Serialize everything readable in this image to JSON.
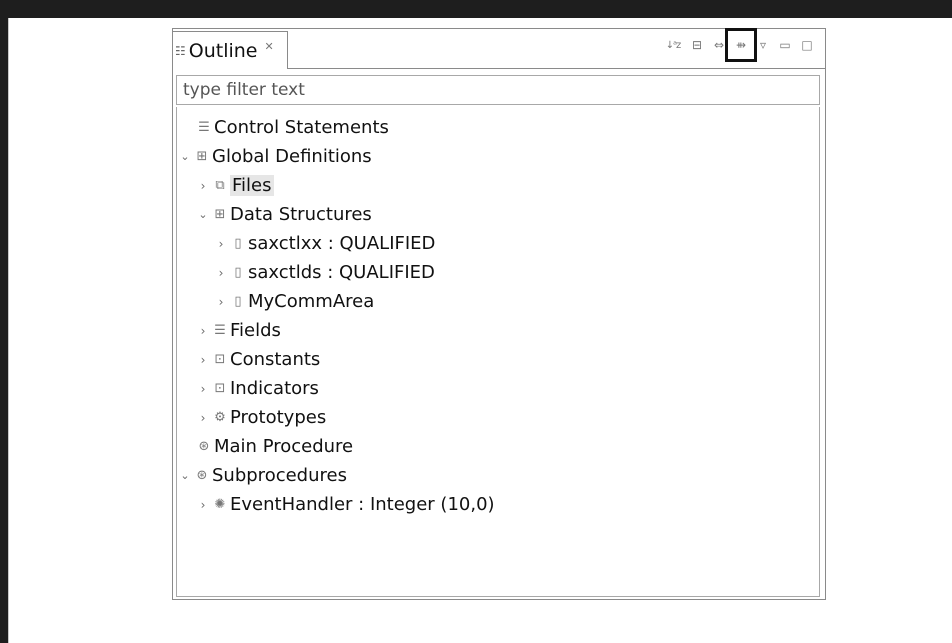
{
  "outline": {
    "tab_label": "Outline",
    "tab_icon": "outline-icon",
    "close_icon": "close-icon",
    "toolbar": {
      "sort_icon": "sort-alphabetical-icon",
      "collapse_icon": "collapse-all-icon",
      "link_icon": "link-with-editor-icon",
      "filter_icon": "hide-fields-icon",
      "menu_icon": "view-menu-icon",
      "minimize_icon": "minimize-icon",
      "maximize_icon": "maximize-icon"
    },
    "filter_placeholder": "type filter text",
    "tree": [
      {
        "label": "Control Statements",
        "icon": "control-statements-icon",
        "twisty": "none",
        "selected": false
      },
      {
        "label": "Global Definitions",
        "icon": "global-definitions-icon",
        "twisty": "expanded",
        "selected": false
      },
      {
        "label": "Files",
        "icon": "files-icon",
        "twisty": "collapsed",
        "selected": true
      },
      {
        "label": "Data Structures",
        "icon": "data-structures-icon",
        "twisty": "expanded",
        "selected": false
      },
      {
        "label": "saxctlxx : QUALIFIED",
        "icon": "data-structure-icon",
        "twisty": "collapsed",
        "selected": false
      },
      {
        "label": "saxctlds : QUALIFIED",
        "icon": "data-structure-icon",
        "twisty": "collapsed",
        "selected": false
      },
      {
        "label": "MyCommArea",
        "icon": "data-structure-icon",
        "twisty": "collapsed",
        "selected": false
      },
      {
        "label": "Fields",
        "icon": "fields-icon",
        "twisty": "collapsed",
        "selected": false
      },
      {
        "label": "Constants",
        "icon": "constants-icon",
        "twisty": "collapsed",
        "selected": false
      },
      {
        "label": "Indicators",
        "icon": "indicators-icon",
        "twisty": "collapsed",
        "selected": false
      },
      {
        "label": "Prototypes",
        "icon": "prototypes-icon",
        "twisty": "collapsed",
        "selected": false
      },
      {
        "label": "Main Procedure",
        "icon": "main-procedure-icon",
        "twisty": "none",
        "selected": false
      },
      {
        "label": "Subprocedures",
        "icon": "subprocedures-icon",
        "twisty": "expanded",
        "selected": false
      },
      {
        "label": "EventHandler : Integer (10,0)",
        "icon": "procedure-icon",
        "twisty": "collapsed",
        "selected": false
      }
    ]
  }
}
